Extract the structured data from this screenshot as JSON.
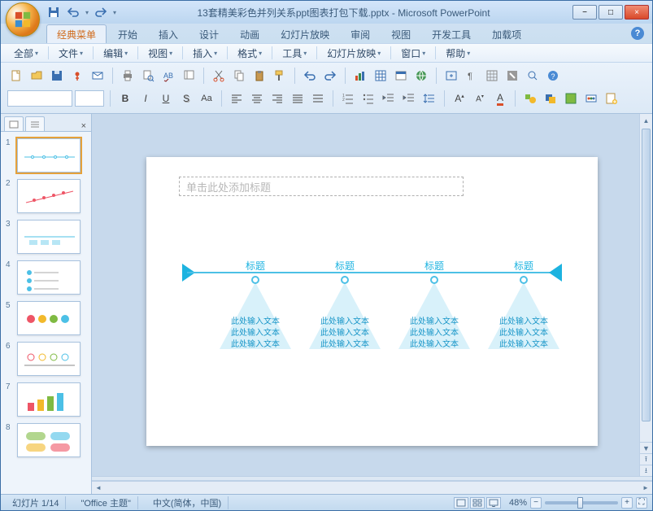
{
  "window": {
    "title_doc": "13套精美彩色并列关系ppt图表打包下载.pptx",
    "title_app": "Microsoft PowerPoint"
  },
  "qat": {
    "save": "save-icon",
    "undo": "undo-icon",
    "redo": "redo-icon"
  },
  "win": {
    "min": "−",
    "max": "□",
    "close": "×"
  },
  "ribbon_tabs": [
    "经典菜单",
    "开始",
    "插入",
    "设计",
    "动画",
    "幻灯片放映",
    "审阅",
    "视图",
    "开发工具",
    "加载项"
  ],
  "ribbon_active": 0,
  "help": "?",
  "menus": [
    "全部",
    "文件",
    "编辑",
    "视图",
    "插入",
    "格式",
    "工具",
    "幻灯片放映",
    "窗口",
    "帮助"
  ],
  "slide": {
    "title_placeholder": "单击此处添加标题",
    "node_labels": [
      "标题",
      "标题",
      "标题",
      "标题"
    ],
    "node_text": "此处输入文本"
  },
  "thumbs": {
    "count": 8,
    "selected": 1
  },
  "status": {
    "slide_counter": "幻灯片 1/14",
    "theme": "\"Office 主题\"",
    "language": "中文(简体，中国)",
    "zoom": "48%"
  },
  "zoom_controls": {
    "minus": "−",
    "plus": "+",
    "fit": "⛶"
  }
}
